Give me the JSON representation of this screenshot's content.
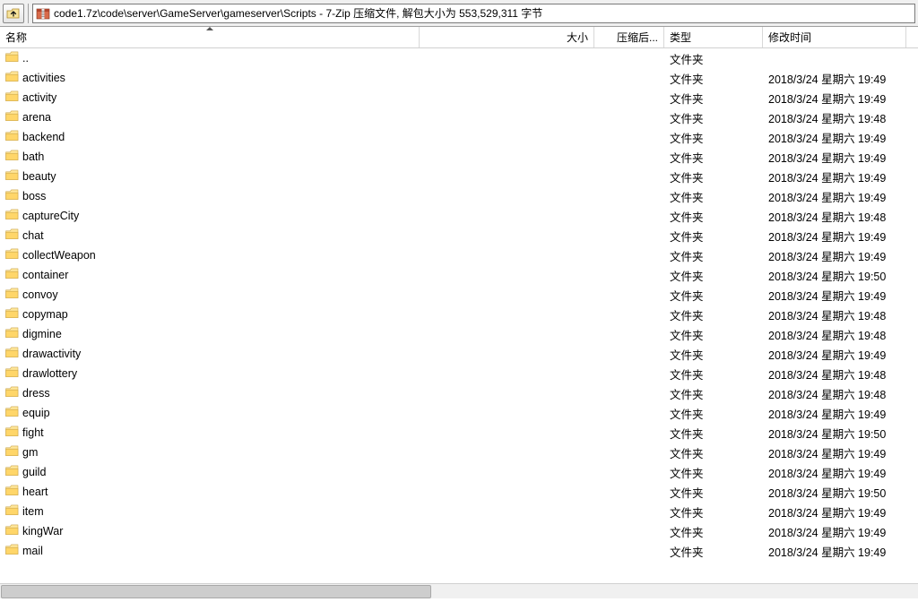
{
  "toolbar": {
    "path": "code1.7z\\code\\server\\GameServer\\gameserver\\Scripts - 7-Zip 压缩文件, 解包大小为 553,529,311 字节"
  },
  "columns": {
    "name": "名称",
    "size": "大小",
    "packed": "压缩后...",
    "type": "类型",
    "date": "修改时间"
  },
  "folder_type_label": "文件夹",
  "rows": [
    {
      "name": "..",
      "type": "文件夹",
      "date": ""
    },
    {
      "name": "activities",
      "type": "文件夹",
      "date": "2018/3/24 星期六 19:49"
    },
    {
      "name": "activity",
      "type": "文件夹",
      "date": "2018/3/24 星期六 19:49"
    },
    {
      "name": "arena",
      "type": "文件夹",
      "date": "2018/3/24 星期六 19:48"
    },
    {
      "name": "backend",
      "type": "文件夹",
      "date": "2018/3/24 星期六 19:49"
    },
    {
      "name": "bath",
      "type": "文件夹",
      "date": "2018/3/24 星期六 19:49"
    },
    {
      "name": "beauty",
      "type": "文件夹",
      "date": "2018/3/24 星期六 19:49"
    },
    {
      "name": "boss",
      "type": "文件夹",
      "date": "2018/3/24 星期六 19:49"
    },
    {
      "name": "captureCity",
      "type": "文件夹",
      "date": "2018/3/24 星期六 19:48"
    },
    {
      "name": "chat",
      "type": "文件夹",
      "date": "2018/3/24 星期六 19:49"
    },
    {
      "name": "collectWeapon",
      "type": "文件夹",
      "date": "2018/3/24 星期六 19:49"
    },
    {
      "name": "container",
      "type": "文件夹",
      "date": "2018/3/24 星期六 19:50"
    },
    {
      "name": "convoy",
      "type": "文件夹",
      "date": "2018/3/24 星期六 19:49"
    },
    {
      "name": "copymap",
      "type": "文件夹",
      "date": "2018/3/24 星期六 19:48"
    },
    {
      "name": "digmine",
      "type": "文件夹",
      "date": "2018/3/24 星期六 19:48"
    },
    {
      "name": "drawactivity",
      "type": "文件夹",
      "date": "2018/3/24 星期六 19:49"
    },
    {
      "name": "drawlottery",
      "type": "文件夹",
      "date": "2018/3/24 星期六 19:48"
    },
    {
      "name": "dress",
      "type": "文件夹",
      "date": "2018/3/24 星期六 19:48"
    },
    {
      "name": "equip",
      "type": "文件夹",
      "date": "2018/3/24 星期六 19:49"
    },
    {
      "name": "fight",
      "type": "文件夹",
      "date": "2018/3/24 星期六 19:50"
    },
    {
      "name": "gm",
      "type": "文件夹",
      "date": "2018/3/24 星期六 19:49"
    },
    {
      "name": "guild",
      "type": "文件夹",
      "date": "2018/3/24 星期六 19:49"
    },
    {
      "name": "heart",
      "type": "文件夹",
      "date": "2018/3/24 星期六 19:50"
    },
    {
      "name": "item",
      "type": "文件夹",
      "date": "2018/3/24 星期六 19:49"
    },
    {
      "name": "kingWar",
      "type": "文件夹",
      "date": "2018/3/24 星期六 19:49"
    },
    {
      "name": "mail",
      "type": "文件夹",
      "date": "2018/3/24 星期六 19:49"
    }
  ]
}
